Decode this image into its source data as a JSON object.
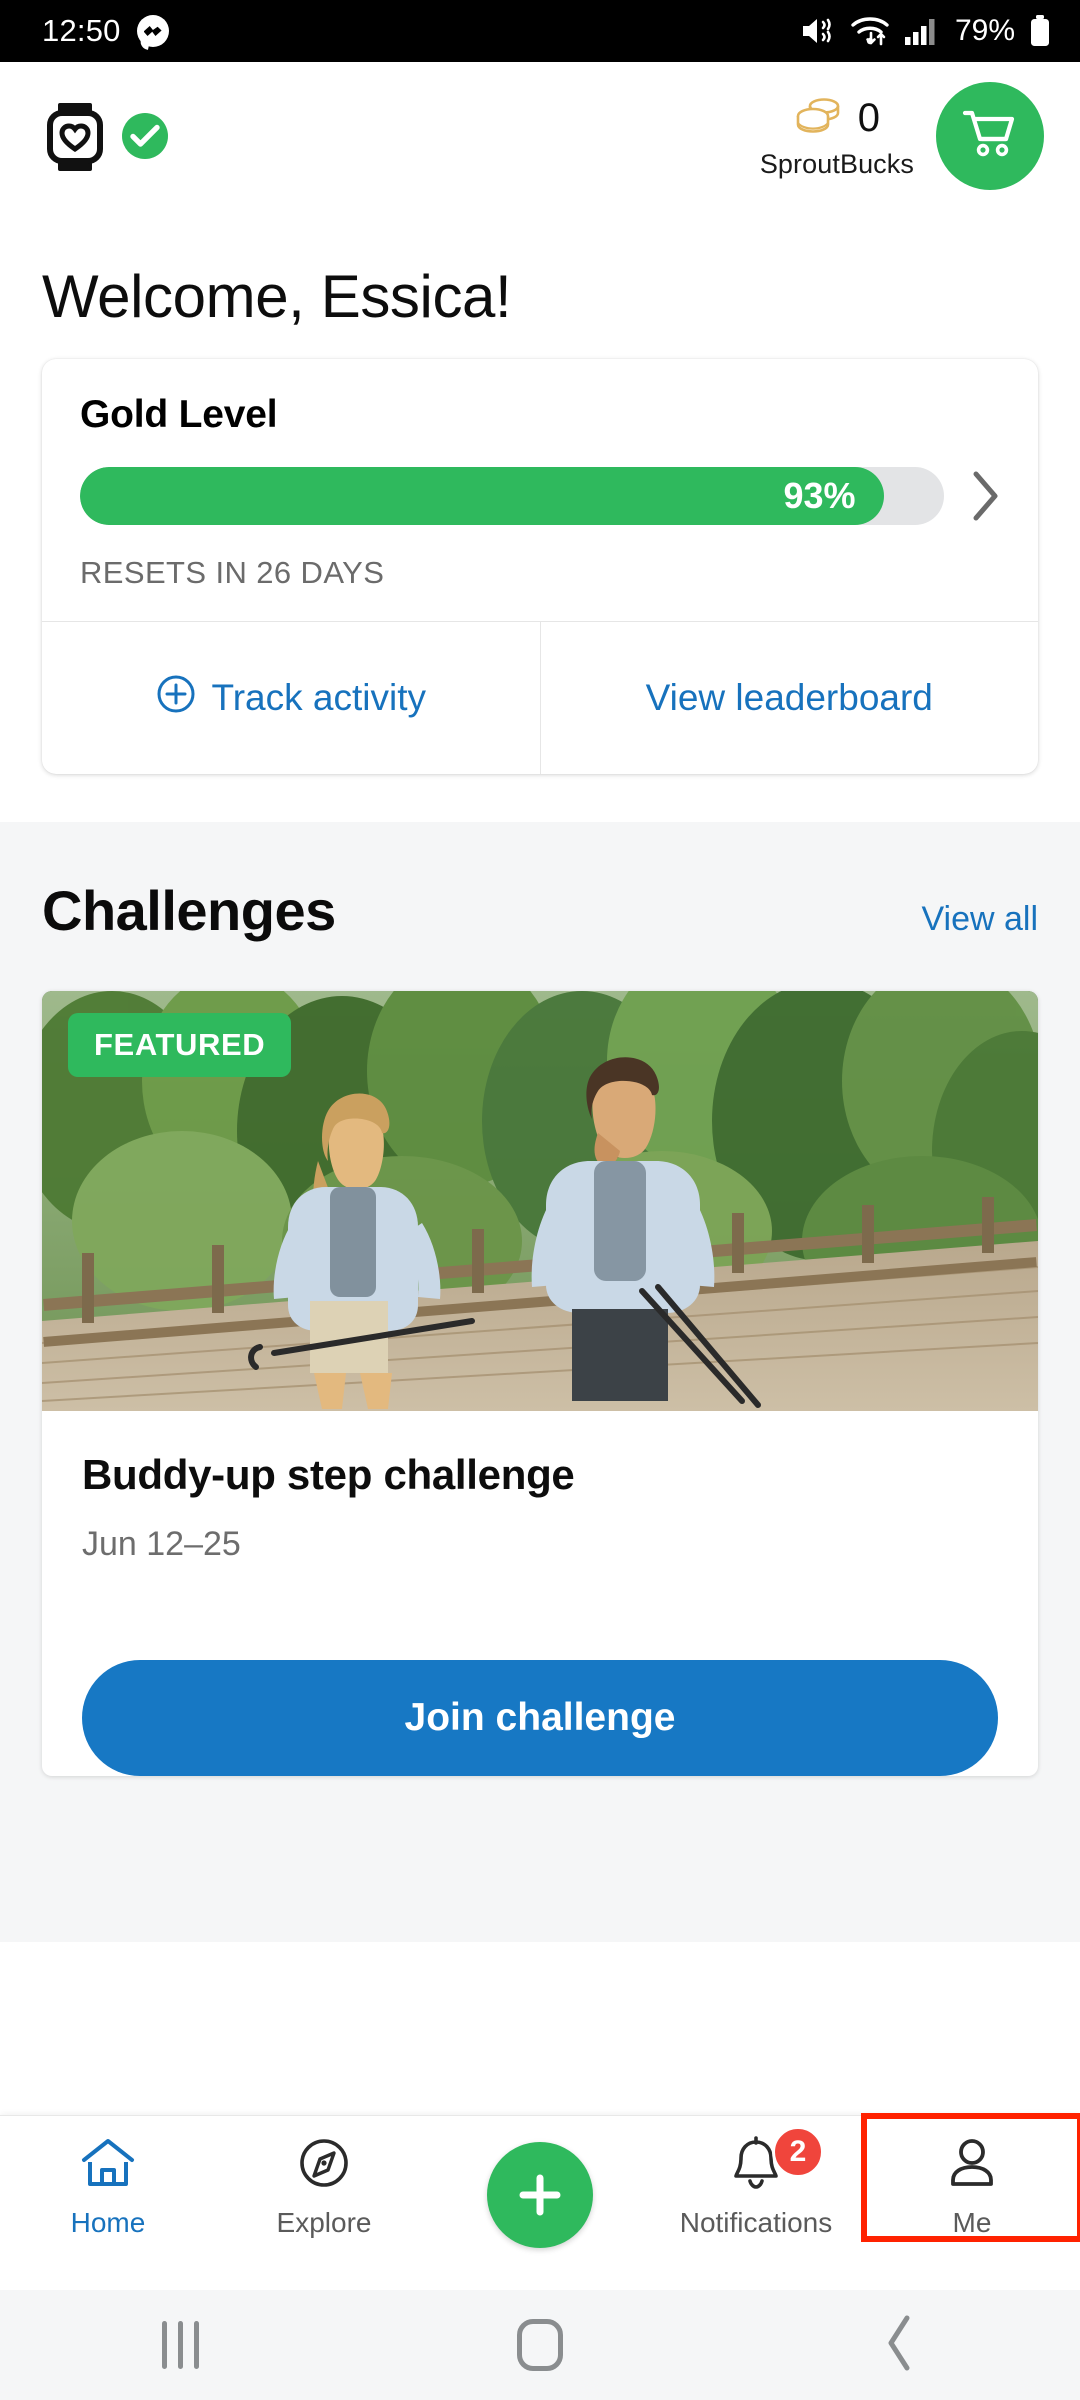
{
  "status_bar": {
    "time": "12:50",
    "messenger_icon": "messenger-icon",
    "mute_icon": "mute-vibrate-icon",
    "wifi_icon": "wifi-icon",
    "signal_icon": "cellular-signal-icon",
    "battery_percent": "79%",
    "battery_icon": "battery-icon"
  },
  "header": {
    "watch_icon": "smartwatch-heart-icon",
    "connected_badge_icon": "check-circle-icon",
    "coins_icon": "coins-icon",
    "sproutbucks_count": "0",
    "sproutbucks_label": "SproutBucks",
    "cart_icon": "shopping-cart-icon"
  },
  "welcome": {
    "greeting": "Welcome, Essica!"
  },
  "level_card": {
    "title": "Gold Level",
    "progress_label": "93%",
    "progress_percent": 93,
    "reset_text": "RESETS IN 26 DAYS",
    "chevron_icon": "chevron-right-icon",
    "actions": [
      {
        "label": "Track activity",
        "icon": "plus-circle-icon"
      },
      {
        "label": "View leaderboard",
        "icon": ""
      }
    ]
  },
  "challenges": {
    "section_title": "Challenges",
    "view_all_label": "View all",
    "card": {
      "badge": "FEATURED",
      "image_alt": "two-hikers-on-wooden-bridge",
      "title": "Buddy-up step challenge",
      "date_range": "Jun 12–25",
      "cta_label": "Join challenge"
    }
  },
  "bottom_nav": {
    "items": [
      {
        "label": "Home",
        "icon": "home-icon",
        "active": true
      },
      {
        "label": "Explore",
        "icon": "compass-icon",
        "active": false
      },
      {
        "label": "",
        "icon": "plus-fab-icon",
        "active": false
      },
      {
        "label": "Notifications",
        "icon": "bell-icon",
        "badge": "2",
        "active": false
      },
      {
        "label": "Me",
        "icon": "person-icon",
        "active": false,
        "selected": true
      }
    ]
  },
  "system_nav": {
    "recents_icon": "recents-icon",
    "home_icon": "home-square-icon",
    "back_icon": "back-chevron-icon"
  },
  "colors": {
    "green": "#2FB95D",
    "blue": "#1772bd",
    "cta_blue": "#1778c4",
    "red_badge": "#f0453c",
    "highlight_red": "#ff2200",
    "section_bg": "#f5f6f7"
  }
}
